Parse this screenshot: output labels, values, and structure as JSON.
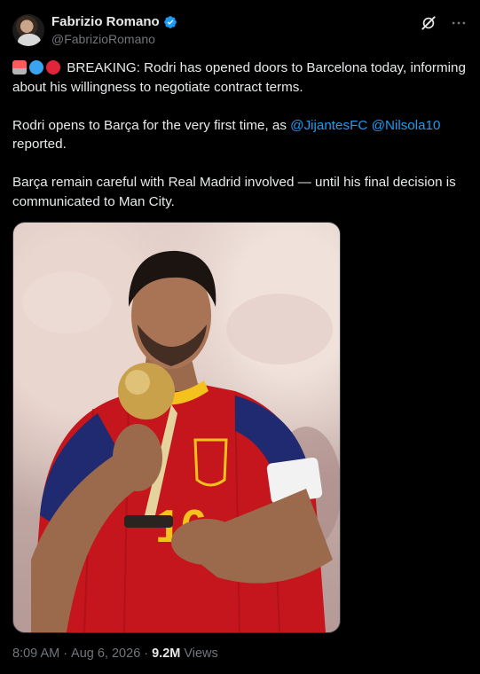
{
  "author": {
    "name": "Fabrizio Romano",
    "handle": "@FabrizioRomano",
    "verified": true
  },
  "header_icons": [
    "grok-icon",
    "more-icon"
  ],
  "tweet": {
    "para1": "BREAKING: Rodri has opened doors to Barcelona today, informing about his willingness to negotiate contract terms.",
    "para2_prefix": "Rodri opens to Barça for the very first time, as ",
    "mention1": "@JijantesFC",
    "mention2": "@Nilsola10",
    "para2_suffix": "reported.",
    "para3": "Barça remain careful with Real Madrid involved — until his final decision is communicated to Man City."
  },
  "media": {
    "shirt_number": "16",
    "alt": "Rodri kissing a golden trophy"
  },
  "meta": {
    "time": "8:09 AM",
    "separator": "·",
    "date": "Aug 6, 2026",
    "views_count": "9.2M",
    "views_label": "Views"
  },
  "colors": {
    "background": "#000000",
    "text": "#e7e9ea",
    "secondary": "#71767b",
    "link": "#1d9bf0",
    "verified": "#1d9bf0"
  }
}
